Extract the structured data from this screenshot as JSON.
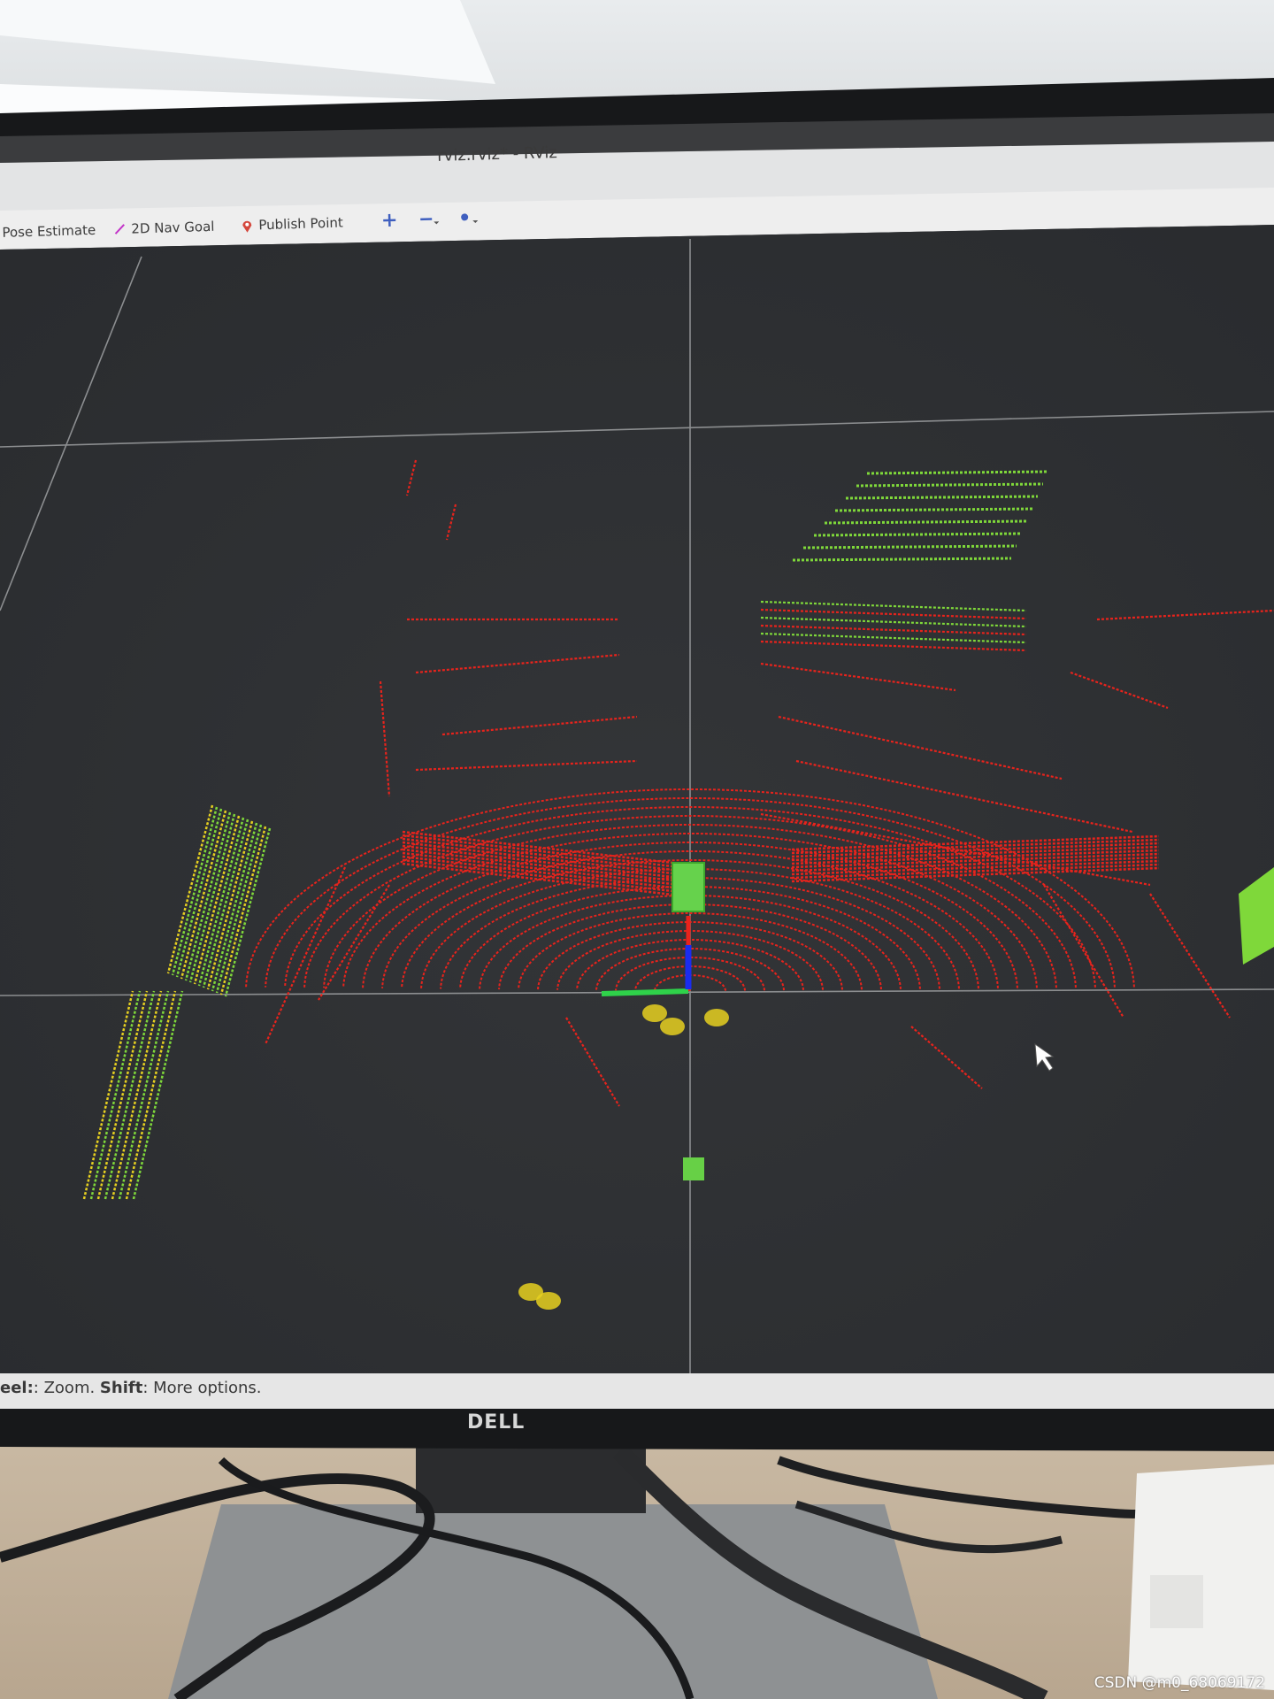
{
  "window": {
    "title": "rviz.rviz* - RViz"
  },
  "toolbar": {
    "items": [
      {
        "label": "Pose Estimate",
        "icon": "pose-estimate-icon"
      },
      {
        "label": "2D Nav Goal",
        "icon": "nav-goal-arrow-icon"
      },
      {
        "label": "Publish Point",
        "icon": "map-pin-icon"
      },
      {
        "label": "",
        "icon": "move-camera-plus-icon"
      },
      {
        "label": "",
        "icon": "minus-dropdown-icon"
      },
      {
        "label": "",
        "icon": "eye-dropdown-icon"
      }
    ]
  },
  "status_bar": {
    "prefix": "eel:",
    "text1": ": Zoom. ",
    "bold": "Shift",
    "text2": ": More options."
  },
  "monitor": {
    "brand": "DELL"
  },
  "watermark": "CSDN @m0_68069172",
  "colors": {
    "viewport_bg": "#2f3133",
    "grid": "#8c8e90",
    "points_red": "#e8231c",
    "points_green": "#7fd83a",
    "points_yellow": "#e6d020",
    "axis_x": "#e8231c",
    "axis_y": "#2fd24a",
    "axis_z": "#1a2cf0"
  }
}
